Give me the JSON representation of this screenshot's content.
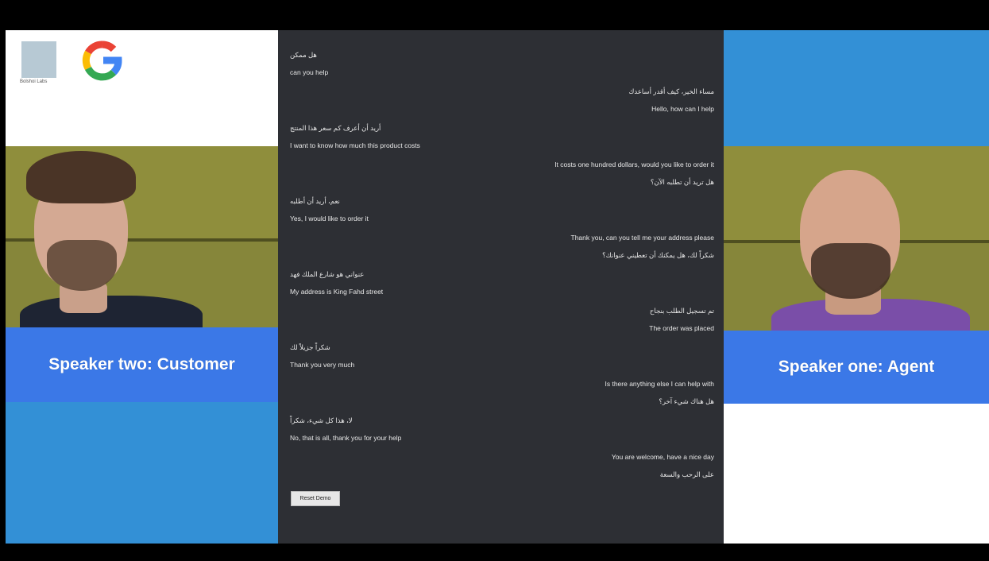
{
  "partner_logo_text": "Bolshoi Labs",
  "speakers": {
    "left_label": "Speaker two: Customer",
    "right_label": "Speaker one: Agent"
  },
  "transcript": [
    {
      "side": "l",
      "text": "هل ممكن"
    },
    {
      "side": "l",
      "text": "can you help"
    },
    {
      "side": "r",
      "text": "مساء الخير، كيف أقدر أساعدك"
    },
    {
      "side": "r",
      "text": "Hello, how can I help"
    },
    {
      "side": "l",
      "text": "أريد أن أعرف كم سعر هذا المنتج"
    },
    {
      "side": "l",
      "text": "I want to know how much this product costs"
    },
    {
      "side": "r",
      "text": "It costs one hundred dollars, would you like to order it"
    },
    {
      "side": "r",
      "text": "هل تريد أن تطلبه الآن؟"
    },
    {
      "side": "l",
      "text": "نعم، أريد أن أطلبه"
    },
    {
      "side": "l",
      "text": "Yes, I would like to order it"
    },
    {
      "side": "r",
      "text": "Thank you, can you tell me your address please"
    },
    {
      "side": "r",
      "text": "شكراً لك، هل يمكنك أن تعطيني عنوانك؟"
    },
    {
      "side": "l",
      "text": "عنواني هو شارع الملك فهد"
    },
    {
      "side": "l",
      "text": "My address is King Fahd street"
    },
    {
      "side": "r",
      "text": "تم تسجيل الطلب بنجاح"
    },
    {
      "side": "r",
      "text": "The order was placed"
    },
    {
      "side": "l",
      "text": "شكراً جزيلاً لك"
    },
    {
      "side": "l",
      "text": "Thank you very much"
    },
    {
      "side": "r",
      "text": "Is there anything else I can help with"
    },
    {
      "side": "r",
      "text": "هل هناك شيء آخر؟"
    },
    {
      "side": "l",
      "text": "لا، هذا كل شيء، شكراً"
    },
    {
      "side": "l",
      "text": "No, that is all, thank you for your help"
    },
    {
      "side": "r",
      "text": "You are welcome, have a nice day"
    },
    {
      "side": "r",
      "text": "على الرحب والسعة"
    }
  ],
  "reset_button_label": "Reset Demo",
  "colors": {
    "band_blue": "#3b78e7",
    "panel_blue": "#3390d6",
    "transcript_bg": "#2d2f34"
  },
  "icons": {
    "google": "google-logo-icon",
    "partner": "partner-logo-icon"
  }
}
